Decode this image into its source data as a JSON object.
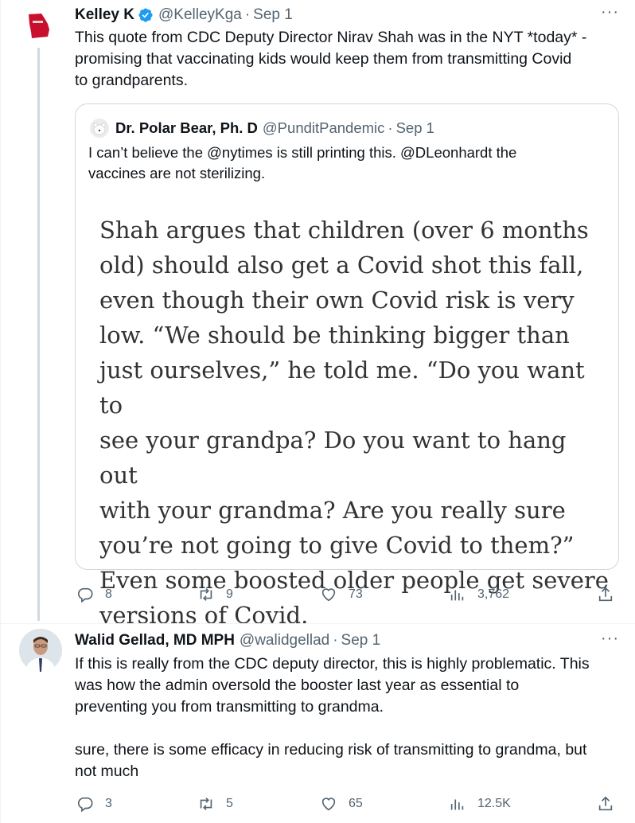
{
  "tweet1": {
    "name": "Kelley K",
    "handle": "@KelleyKga",
    "sep": "·",
    "date": "Sep 1",
    "text": "This quote from CDC Deputy Director Nirav Shah was in the NYT *today* -\npromising that vaccinating kids would keep them from transmitting Covid\nto grandparents.",
    "quote": {
      "name": "Dr. Polar Bear, Ph. D",
      "handle": "@PunditPandemic",
      "sep": "·",
      "date": "Sep 1",
      "text": "I can’t believe the @nytimes is still printing this. @DLeonhardt the\nvaccines are not sterilizing.",
      "image_text": "Shah argues that children (over 6 months\nold) should also get a Covid shot this fall,\neven though their own Covid risk is very\nlow. “We should be thinking bigger than\njust ourselves,” he told me. “Do you want to\nsee your grandpa? Do you want to hang out\nwith your grandma? Are you really sure\nyou’re not going to give Covid to them?”\nEven some boosted older people get severe\nversions of Covid."
    },
    "actions": {
      "replies": "8",
      "retweets": "9",
      "likes": "73",
      "views": "3,762"
    }
  },
  "tweet2": {
    "name": "Walid Gellad, MD MPH",
    "handle": "@walidgellad",
    "sep": "·",
    "date": "Sep 1",
    "text": "If this is really from the CDC deputy director, this is highly problematic. This\nwas how the admin oversold the booster last year as essential to\npreventing you from transmitting to grandma.\n\nsure, there is some efficacy in reducing risk of transmitting to grandma, but\nnot much",
    "actions": {
      "replies": "3",
      "retweets": "5",
      "likes": "65",
      "views": "12.5K"
    }
  },
  "more_label": "···",
  "colors": {
    "verified": "#1d9bf0",
    "secondary": "#536471",
    "border": "#cfd9de",
    "georgia_red": "#c8102e"
  }
}
